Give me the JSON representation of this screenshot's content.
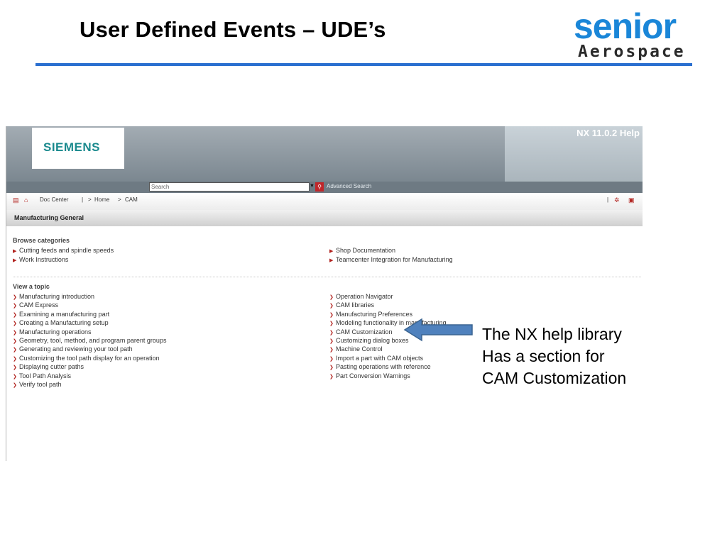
{
  "slide": {
    "title": "User Defined Events – UDE’s",
    "logo": {
      "brand": "senior",
      "sub": "Aerospace",
      "brand_color": "#1a86d8"
    },
    "callout": {
      "lines": [
        "The NX help library",
        "Has a section for",
        "CAM Customization"
      ],
      "arrow_color": "#4f81bd"
    }
  },
  "help_page": {
    "brand": "SIEMENS",
    "product_title": "NX 11.0.2 Help",
    "search": {
      "placeholder": "Search",
      "advanced_label": "Advanced Search"
    },
    "breadcrumb": {
      "doc_center": "Doc Center",
      "home": "Home",
      "current": "CAM",
      "separator": ">",
      "bar": "|"
    },
    "section_title": "Manufacturing General",
    "browse": {
      "heading": "Browse categories",
      "left": [
        "Cutting feeds and spindle speeds",
        "Work Instructions"
      ],
      "right": [
        "Shop Documentation",
        "Teamcenter Integration for Manufacturing"
      ]
    },
    "topics": {
      "heading": "View a topic",
      "left": [
        "Manufacturing introduction",
        "CAM Express",
        "Examining a manufacturing part",
        "Creating a Manufacturing setup",
        "Manufacturing operations",
        "Geometry, tool, method, and program parent groups",
        "Generating and reviewing your tool path",
        "Customizing the tool path display for an operation",
        "Displaying cutter paths",
        "Tool Path Analysis",
        "Verify tool path"
      ],
      "right": [
        "Operation Navigator",
        "CAM libraries",
        "Manufacturing Preferences",
        "Modeling functionality in manufacturing",
        "CAM Customization",
        "Customizing dialog boxes",
        "Machine Control",
        "Import a part with CAM objects",
        "Pasting operations with reference",
        "Part Conversion Warnings"
      ]
    },
    "icons": {
      "doc": "document-icon",
      "home": "home-icon",
      "settings": "gear-icon",
      "print": "print-icon"
    }
  }
}
